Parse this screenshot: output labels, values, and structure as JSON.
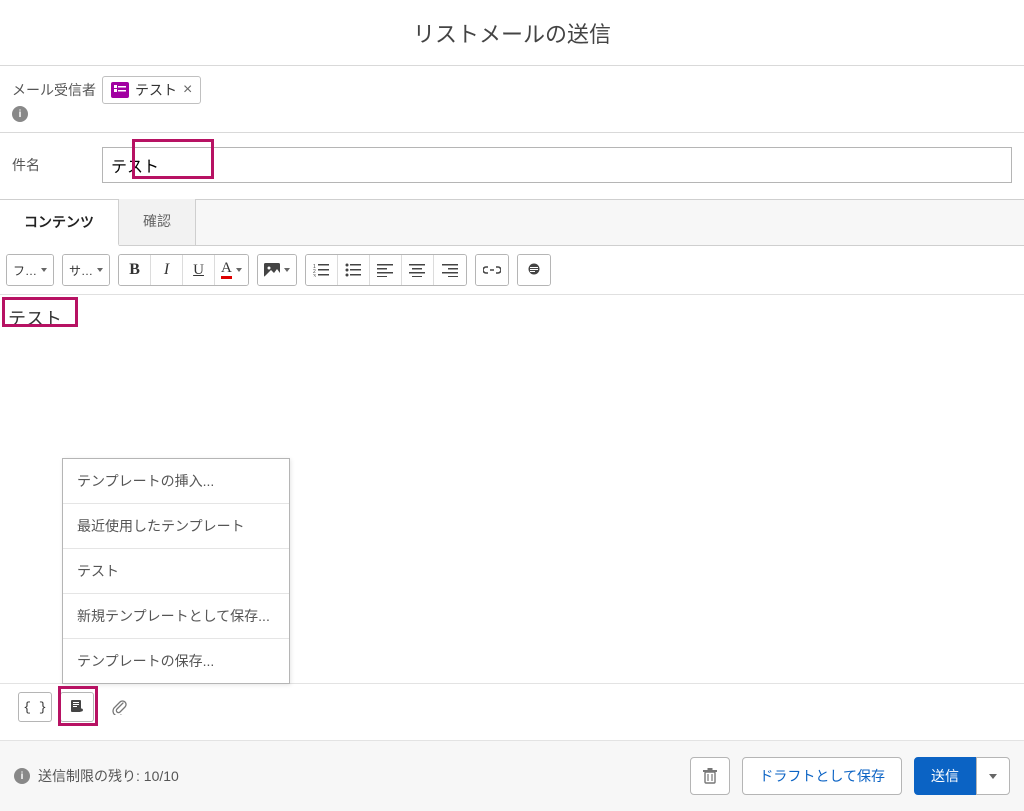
{
  "title": "リストメールの送信",
  "recipients": {
    "label": "メール受信者",
    "chip_text": "テスト"
  },
  "subject": {
    "label": "件名",
    "value": "テスト"
  },
  "tabs": {
    "content": "コンテンツ",
    "confirm": "確認"
  },
  "toolbar": {
    "font_family_short": "フ…",
    "font_size_short": "サ…"
  },
  "editor": {
    "body": "テスト"
  },
  "context_menu": {
    "insert_template": "テンプレートの挿入...",
    "recent_templates": "最近使用したテンプレート",
    "template_test": "テスト",
    "save_as_new": "新規テンプレートとして保存...",
    "save_template": "テンプレートの保存..."
  },
  "footer": {
    "limit_text": "送信制限の残り: 10/10",
    "save_draft": "ドラフトとして保存",
    "send": "送信"
  }
}
